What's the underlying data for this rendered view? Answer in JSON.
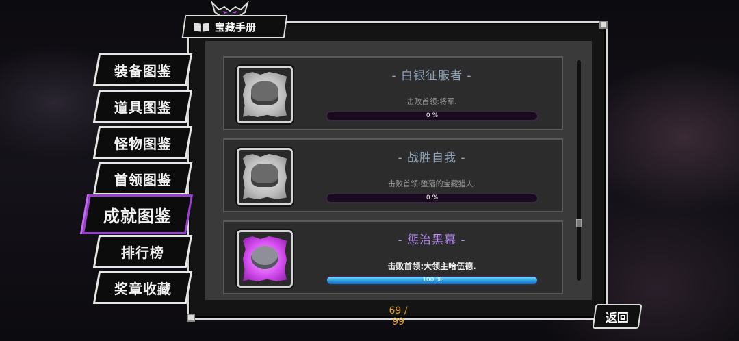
{
  "window": {
    "title": "宝藏手册"
  },
  "sidebar": {
    "items": [
      {
        "label": "装备图鉴",
        "active": false
      },
      {
        "label": "道具图鉴",
        "active": false
      },
      {
        "label": "怪物图鉴",
        "active": false
      },
      {
        "label": "首领图鉴",
        "active": false
      },
      {
        "label": "成就图鉴",
        "active": true
      },
      {
        "label": "排行榜",
        "active": false
      },
      {
        "label": "奖章收藏",
        "active": false
      }
    ]
  },
  "achievements": [
    {
      "title": "- 白银征服者 -",
      "description": "击败首领:将军.",
      "progress_label": "0 %",
      "progress": 0,
      "icon": "armored-beast-icon",
      "color": "gray"
    },
    {
      "title": "- 战胜自我 -",
      "description": "击败首领:堕落的宝藏猎人.",
      "progress_label": "0 %",
      "progress": 0,
      "icon": "horned-monster-icon",
      "color": "gray"
    },
    {
      "title": "- 惩治黑幕 -",
      "description": "击败首领:大领主哈伍德.",
      "progress_label": "100 %",
      "progress": 1.0,
      "icon": "hooded-ghost-icon",
      "color": "purple"
    }
  ],
  "footer": {
    "count": "69 / 99",
    "back_label": "返回"
  },
  "colors": {
    "accent_purple": "#9b3fd0",
    "progress_blue": "#2a9be0",
    "count_gold": "#e6a21c"
  }
}
